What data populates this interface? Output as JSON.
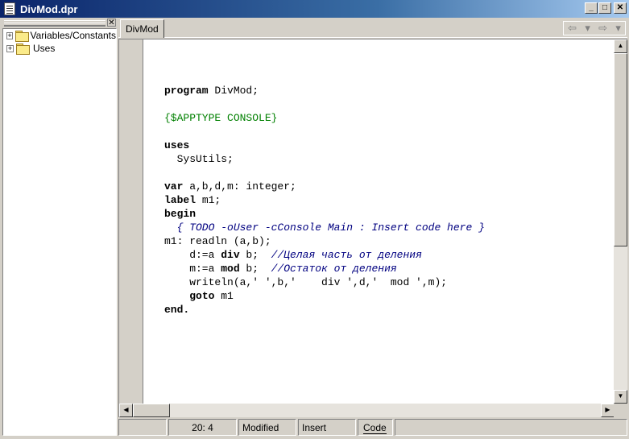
{
  "window": {
    "title": "DivMod.dpr",
    "minimize": "_",
    "maximize": "□",
    "close": "✕"
  },
  "explorer": {
    "close": "✕",
    "items": [
      {
        "expander": "+",
        "label": "Variables/Constants"
      },
      {
        "expander": "+",
        "label": "Uses"
      }
    ]
  },
  "editor": {
    "tab": "DivMod",
    "nav": {
      "back": "⇦",
      "back_drop": "▾",
      "forward": "⇨",
      "forward_drop": "▾"
    }
  },
  "code": {
    "l1_kw": "program",
    "l1_rest": " DivMod;",
    "l2_dir": "{$APPTYPE CONSOLE}",
    "l3_kw": "uses",
    "l4": "  SysUtils;",
    "l5_kw": "var",
    "l5_rest": " a,b,d,m: integer;",
    "l6_kw": "label",
    "l6_rest": " m1;",
    "l7_kw": "begin",
    "l8_cmt": "  { TODO -oUser -cConsole Main : Insert code here }",
    "l9": "m1: readln (a,b);",
    "l10_a": "    d:=a ",
    "l10_kw": "div",
    "l10_b": " b;  ",
    "l10_cmt": "//Целая часть от деления",
    "l11_a": "    m:=a ",
    "l11_kw": "mod",
    "l11_b": " b;  ",
    "l11_cmt": "//Остаток от деления",
    "l12": "    writeln(a,' ',b,'    div ',d,'  mod ',m);",
    "l13_pre": "    ",
    "l13_kw": "goto",
    "l13_rest": " m1",
    "l14_kw": "end."
  },
  "status": {
    "position": "20:   4",
    "modified": "Modified",
    "mode": "Insert",
    "view_tab": "Code"
  }
}
